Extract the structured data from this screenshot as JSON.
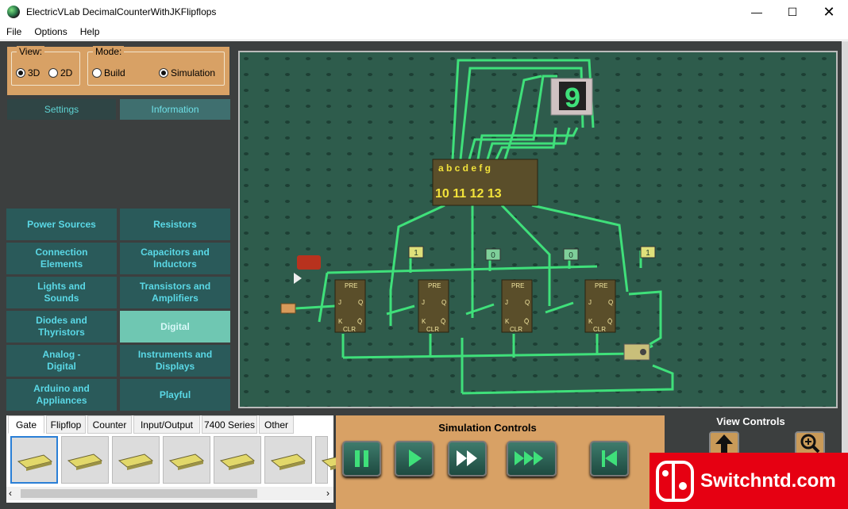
{
  "window": {
    "title": "ElectricVLab  DecimalCounterWithJKFlipflops"
  },
  "menu": [
    "File",
    "Options",
    "Help"
  ],
  "view_group": {
    "title": "View:",
    "options": [
      "3D",
      "2D"
    ],
    "selected": "3D"
  },
  "mode_group": {
    "title": "Mode:",
    "options": [
      "Build",
      "Simulation"
    ],
    "selected": "Simulation"
  },
  "panel_tabs": {
    "settings": "Settings",
    "information": "Information",
    "selected": "Information"
  },
  "categories": [
    {
      "label": "Power Sources"
    },
    {
      "label": "Resistors"
    },
    {
      "label": "Connection\nElements"
    },
    {
      "label": "Capacitors and\nInductors"
    },
    {
      "label": "Lights and\nSounds"
    },
    {
      "label": "Transistors and\nAmplifiers"
    },
    {
      "label": "Diodes and\nThyristors"
    },
    {
      "label": "Digital",
      "selected": true
    },
    {
      "label": "Analog -\nDigital"
    },
    {
      "label": "Instruments and\nDisplays"
    },
    {
      "label": "Arduino and\nAppliances"
    },
    {
      "label": "Playful"
    }
  ],
  "circuit": {
    "display_digit": "9",
    "decoder_pins_top": [
      "a",
      "b",
      "c",
      "d",
      "e",
      "f",
      "g"
    ],
    "decoder_pins_bottom": [
      "10",
      "11",
      "12",
      "13"
    ],
    "flipflop_labels": {
      "pre": "PRE",
      "clr": "CLR",
      "j": "J",
      "k": "K",
      "q": "Q",
      "qbar": "Q̄"
    },
    "probe_values": [
      "1",
      "0",
      "0",
      "1"
    ]
  },
  "component_tabs": [
    "Gate",
    "Flipflop",
    "Counter",
    "Input/Output",
    "7400 Series",
    "Other"
  ],
  "component_tab_selected": "Gate",
  "simulation_controls": {
    "title": "Simulation Controls",
    "buttons": [
      "pause",
      "play",
      "fast-forward",
      "faster-forward",
      "reset"
    ]
  },
  "view_controls": {
    "title": "View Controls"
  },
  "watermark": {
    "text": "Switchntd.com"
  },
  "colors": {
    "panel_orange": "#d8a165",
    "category_bg": "#2a5a5a",
    "category_text": "#5ad8e6",
    "board": "#2e5c4c",
    "wire": "#3fe07a"
  }
}
